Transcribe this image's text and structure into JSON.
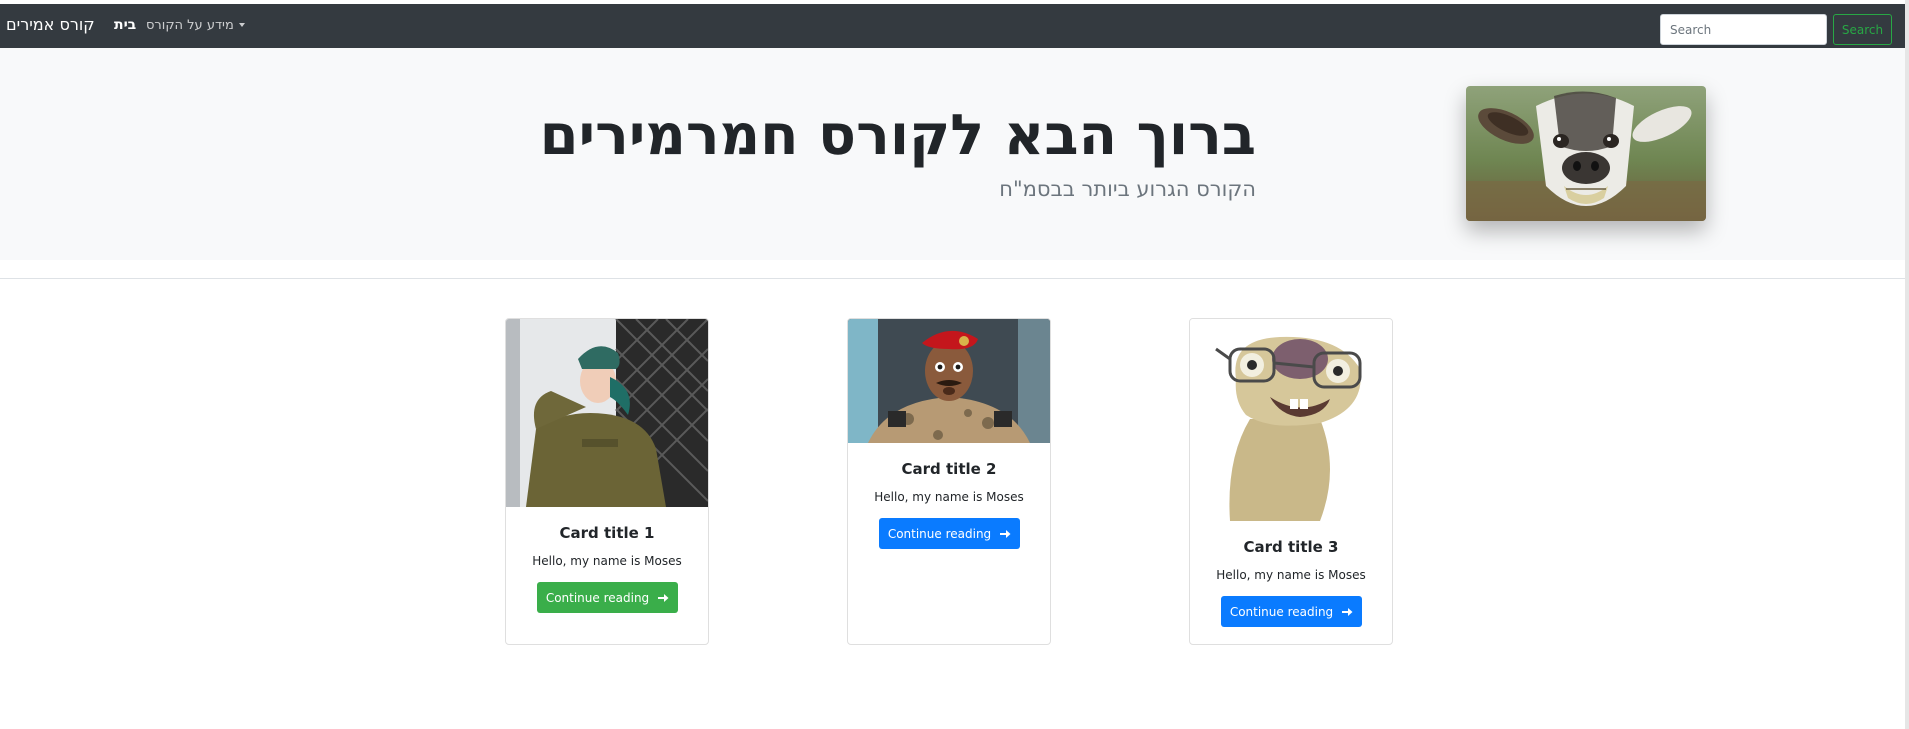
{
  "navbar": {
    "brand": "קורס אמירים",
    "home": "בית",
    "dropdown": "מידע על הקורס",
    "search_placeholder": "Search",
    "search_button": "Search"
  },
  "hero": {
    "title": "ברוך הבא לקורס חמרמירים",
    "subtitle": "הקורס הגרוע ביותר בבסמ\"ח",
    "image": "goat-photo"
  },
  "cards": [
    {
      "image": "soldier-saluting-photo",
      "title": "Card title 1",
      "text": "Hello, my name is Moses",
      "button": "Continue reading",
      "button_icon": "arrow-right-icon",
      "button_color": "#3aae4a"
    },
    {
      "image": "officer-red-beret-photo",
      "title": "Card title 2",
      "text": "Hello, my name is Moses",
      "button": "Continue reading",
      "button_icon": "arrow-right-icon",
      "button_color": "#0a7bff"
    },
    {
      "image": "sloth-with-glasses-cartoon",
      "title": "Card title 3",
      "text": "Hello, my name is Moses",
      "button": "Continue reading",
      "button_icon": "arrow-right-icon",
      "button_color": "#0a7bff"
    }
  ],
  "colors": {
    "navbar": "#343a40",
    "hero_bg": "#f8f9fa",
    "success": "#28a745",
    "primary": "#0a7bff"
  }
}
